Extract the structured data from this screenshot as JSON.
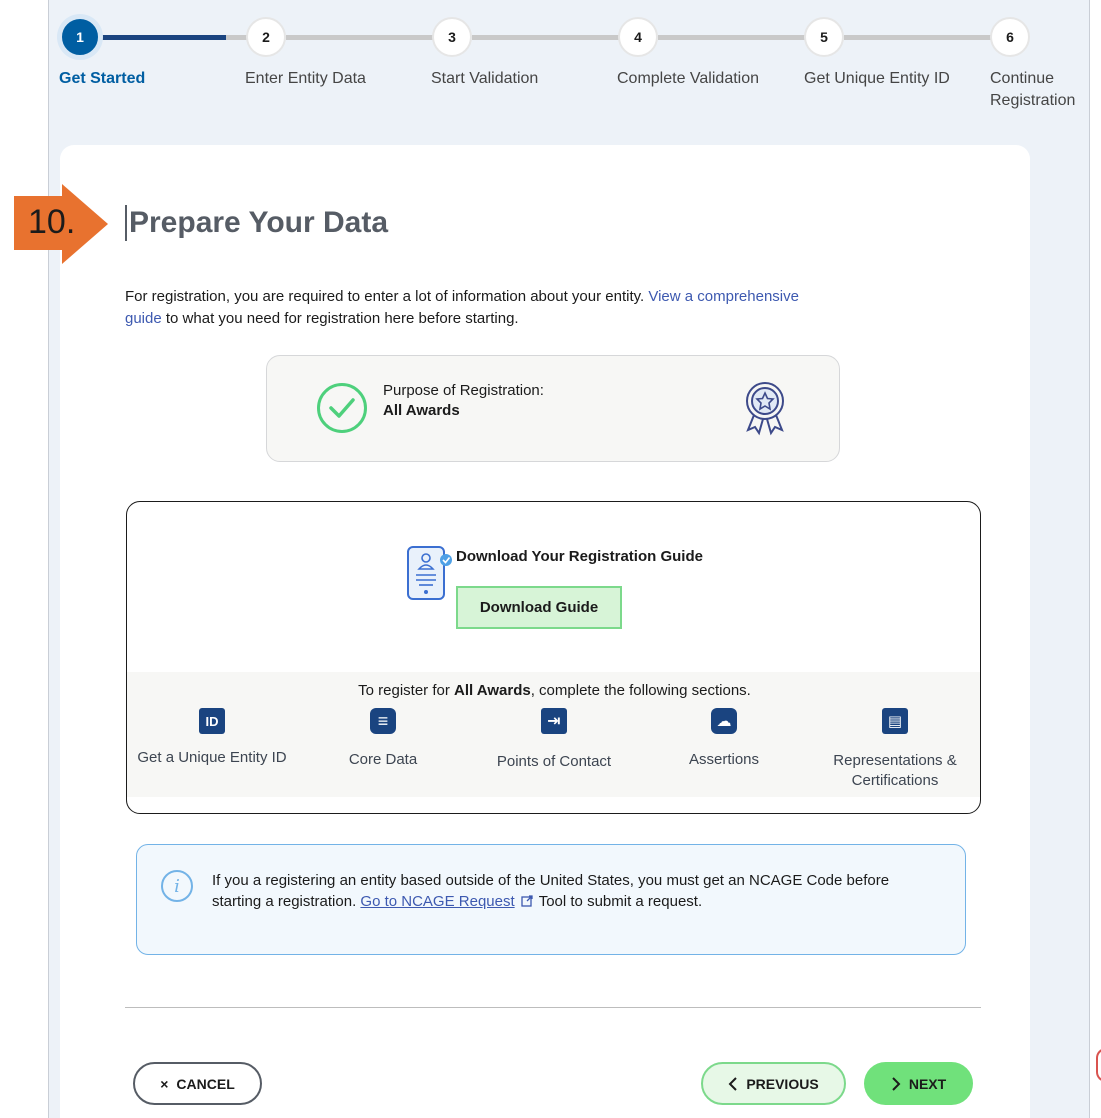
{
  "stepper": {
    "steps": [
      {
        "number": "1",
        "label": "Get Started",
        "active": true
      },
      {
        "number": "2",
        "label": "Enter Entity Data"
      },
      {
        "number": "3",
        "label": "Start Validation"
      },
      {
        "number": "4",
        "label": "Complete Validation"
      },
      {
        "number": "5",
        "label": "Get Unique Entity ID"
      },
      {
        "number": "6",
        "label_line1": "Continue",
        "label_line2": "Registration"
      }
    ]
  },
  "callout": {
    "number": "10."
  },
  "page": {
    "title": "Prepare Your Data",
    "intro_before": "For registration, you are required to enter a lot of information about your entity. ",
    "intro_link_line1": "View a comprehensive",
    "intro_link_line2": "guide",
    "intro_after": " to what you need for registration here before starting."
  },
  "purpose": {
    "label": "Purpose of Registration:",
    "value": "All Awards"
  },
  "guide": {
    "title": "Download Your Registration Guide",
    "button": "Download Guide",
    "sections_intro_before": "To register for ",
    "sections_intro_bold": "All Awards",
    "sections_intro_after": ", complete the following sections.",
    "sections": [
      {
        "label": "Get a Unique Entity ID",
        "icon": "id-icon",
        "glyph": "ID"
      },
      {
        "label": "Core Data",
        "icon": "database-icon",
        "glyph": "≡"
      },
      {
        "label": "Points of Contact",
        "icon": "contact-door-icon",
        "glyph": "⇥"
      },
      {
        "label": "Assertions",
        "icon": "cloud-icon",
        "glyph": "☁"
      },
      {
        "label_line1": "Representations &",
        "label_line2": "Certifications",
        "icon": "certificate-icon",
        "glyph": "▤"
      }
    ]
  },
  "info": {
    "text_before": "If you a registering an entity based outside of the United States, you must get an NCAGE Code before starting a registration. ",
    "link": "Go to NCAGE Request",
    "text_after": " Tool to submit a request."
  },
  "buttons": {
    "cancel": "CANCEL",
    "previous": "PREVIOUS",
    "next": "NEXT"
  },
  "colors": {
    "primary": "#005ea2",
    "progress": "#1a4480",
    "green": "#70e17b",
    "callout": "#e8722f",
    "info_border": "#73b3e7"
  }
}
